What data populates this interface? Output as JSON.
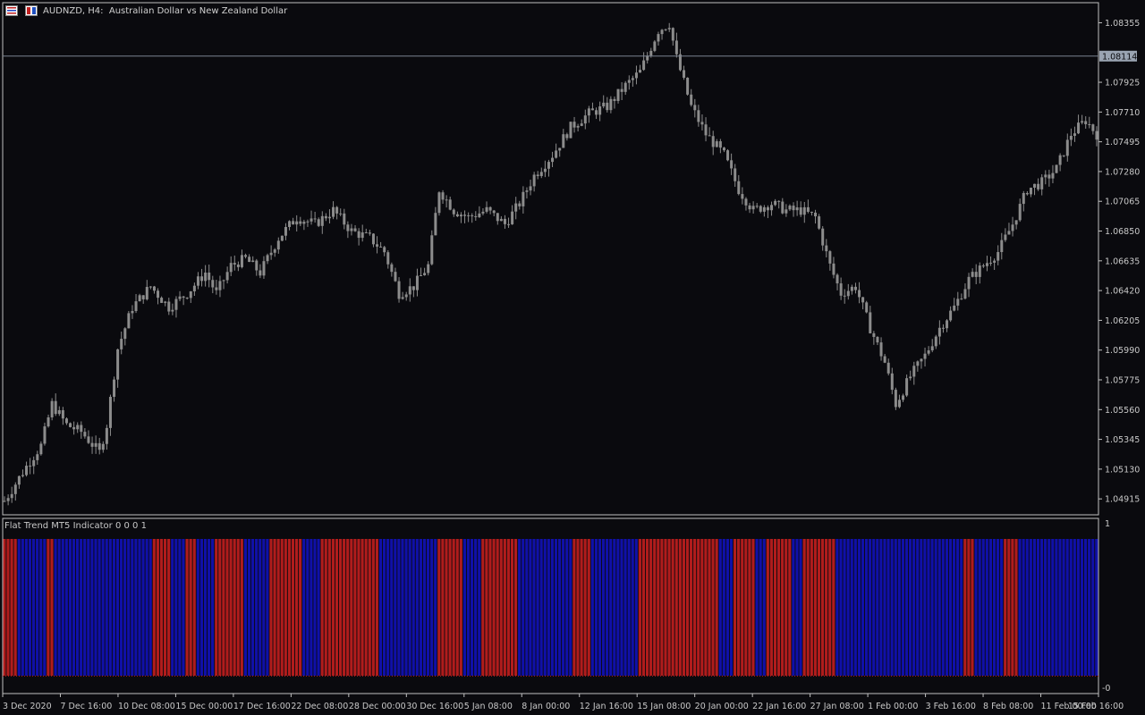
{
  "header": {
    "symbol": "AUDNZD, H4:",
    "description": "Australian Dollar vs New Zealand Dollar"
  },
  "indicator": {
    "title": "Flat Trend MT5 Indicator 0 0 0 1",
    "scale_top": "1",
    "scale_bottom": "-0"
  },
  "colors": {
    "background": "#0a0a0e",
    "candle": "#8c8c8c",
    "grid_frame": "#c0c0c0",
    "trend_blue": "#1010a8",
    "trend_red": "#b01c1c",
    "price_line": "#7a8290",
    "price_label_bg": "#9aa4b2"
  },
  "chart_data": {
    "type": "candlestick",
    "symbol": "AUDNZD",
    "timeframe": "H4",
    "current_price": "1.08114",
    "ylim": [
      1.048,
      1.085
    ],
    "price_ticks": [
      "1.08355",
      "1.07925",
      "1.07710",
      "1.07495",
      "1.07280",
      "1.07065",
      "1.06850",
      "1.06635",
      "1.06420",
      "1.06205",
      "1.05990",
      "1.05775",
      "1.05560",
      "1.05345",
      "1.05130",
      "1.04915"
    ],
    "time_ticks": [
      "3 Dec 2020",
      "7 Dec 16:00",
      "10 Dec 08:00",
      "15 Dec 00:00",
      "17 Dec 16:00",
      "22 Dec 08:00",
      "28 Dec 00:00",
      "30 Dec 16:00",
      "5 Jan 08:00",
      "8 Jan 00:00",
      "12 Jan 16:00",
      "15 Jan 08:00",
      "20 Jan 00:00",
      "22 Jan 16:00",
      "27 Jan 08:00",
      "1 Feb 00:00",
      "3 Feb 16:00",
      "8 Feb 08:00",
      "11 Feb 00:00",
      "15 Feb 16:00"
    ],
    "path_points": [
      [
        0,
        1.049
      ],
      [
        6,
        1.0515
      ],
      [
        10,
        1.053
      ],
      [
        13,
        1.056
      ],
      [
        17,
        1.0545
      ],
      [
        21,
        1.054
      ],
      [
        26,
        1.0525
      ],
      [
        28,
        1.0545
      ],
      [
        31,
        1.06
      ],
      [
        35,
        1.063
      ],
      [
        40,
        1.0645
      ],
      [
        45,
        1.063
      ],
      [
        50,
        1.064
      ],
      [
        55,
        1.0655
      ],
      [
        58,
        1.064
      ],
      [
        62,
        1.066
      ],
      [
        66,
        1.0665
      ],
      [
        70,
        1.0655
      ],
      [
        75,
        1.068
      ],
      [
        80,
        1.0695
      ],
      [
        85,
        1.069
      ],
      [
        90,
        1.07
      ],
      [
        95,
        1.0685
      ],
      [
        100,
        1.068
      ],
      [
        104,
        1.067
      ],
      [
        108,
        1.064
      ],
      [
        112,
        1.0645
      ],
      [
        116,
        1.066
      ],
      [
        119,
        1.0715
      ],
      [
        123,
        1.07
      ],
      [
        127,
        1.0695
      ],
      [
        132,
        1.07
      ],
      [
        137,
        1.069
      ],
      [
        141,
        1.0705
      ],
      [
        145,
        1.0725
      ],
      [
        150,
        1.074
      ],
      [
        155,
        1.076
      ],
      [
        160,
        1.077
      ],
      [
        165,
        1.0775
      ],
      [
        170,
        1.079
      ],
      [
        174,
        1.08
      ],
      [
        179,
        1.083
      ],
      [
        182,
        1.0835
      ],
      [
        184,
        1.081
      ],
      [
        188,
        1.0775
      ],
      [
        192,
        1.0755
      ],
      [
        197,
        1.074
      ],
      [
        201,
        1.0715
      ],
      [
        205,
        1.07
      ],
      [
        210,
        1.0705
      ],
      [
        214,
        1.07
      ],
      [
        218,
        1.07
      ],
      [
        222,
        1.0695
      ],
      [
        226,
        1.066
      ],
      [
        229,
        1.064
      ],
      [
        233,
        1.0645
      ],
      [
        237,
        1.0615
      ],
      [
        241,
        1.059
      ],
      [
        244,
        1.056
      ],
      [
        248,
        1.058
      ],
      [
        252,
        1.0595
      ],
      [
        256,
        1.0615
      ],
      [
        260,
        1.063
      ],
      [
        264,
        1.065
      ],
      [
        268,
        1.066
      ],
      [
        272,
        1.067
      ],
      [
        276,
        1.069
      ],
      [
        280,
        1.0715
      ],
      [
        284,
        1.072
      ],
      [
        288,
        1.073
      ],
      [
        292,
        1.0755
      ],
      [
        296,
        1.0765
      ],
      [
        299,
        1.0755
      ]
    ],
    "candles": 300,
    "segments": [
      {
        "trend": "down",
        "start": 0,
        "end": 3
      },
      {
        "trend": "up",
        "start": 4,
        "end": 11
      },
      {
        "trend": "down",
        "start": 12,
        "end": 13
      },
      {
        "trend": "up",
        "start": 14,
        "end": 40
      },
      {
        "trend": "down",
        "start": 41,
        "end": 45
      },
      {
        "trend": "up",
        "start": 46,
        "end": 49
      },
      {
        "trend": "down",
        "start": 50,
        "end": 52
      },
      {
        "trend": "up",
        "start": 53,
        "end": 57
      },
      {
        "trend": "down",
        "start": 58,
        "end": 65
      },
      {
        "trend": "up",
        "start": 66,
        "end": 72
      },
      {
        "trend": "down",
        "start": 73,
        "end": 81
      },
      {
        "trend": "up",
        "start": 82,
        "end": 86
      },
      {
        "trend": "down",
        "start": 87,
        "end": 102
      },
      {
        "trend": "up",
        "start": 103,
        "end": 118
      },
      {
        "trend": "down",
        "start": 119,
        "end": 125
      },
      {
        "trend": "up",
        "start": 126,
        "end": 130
      },
      {
        "trend": "down",
        "start": 131,
        "end": 140
      },
      {
        "trend": "up",
        "start": 141,
        "end": 155
      },
      {
        "trend": "down",
        "start": 156,
        "end": 160
      },
      {
        "trend": "up",
        "start": 161,
        "end": 173
      },
      {
        "trend": "down",
        "start": 174,
        "end": 195
      },
      {
        "trend": "up",
        "start": 196,
        "end": 199
      },
      {
        "trend": "down",
        "start": 200,
        "end": 205
      },
      {
        "trend": "up",
        "start": 206,
        "end": 208
      },
      {
        "trend": "down",
        "start": 209,
        "end": 215
      },
      {
        "trend": "up",
        "start": 216,
        "end": 218
      },
      {
        "trend": "down",
        "start": 219,
        "end": 227
      },
      {
        "trend": "up",
        "start": 228,
        "end": 262
      },
      {
        "trend": "down",
        "start": 263,
        "end": 265
      },
      {
        "trend": "up",
        "start": 266,
        "end": 273
      },
      {
        "trend": "down",
        "start": 274,
        "end": 277
      },
      {
        "trend": "up",
        "start": 278,
        "end": 299
      }
    ]
  }
}
